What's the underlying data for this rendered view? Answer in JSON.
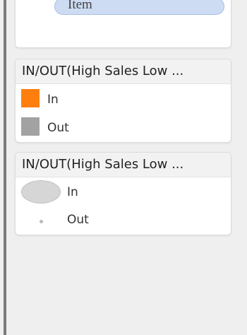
{
  "top_panel": {
    "item_label": "Item"
  },
  "color_legend": {
    "title": "IN/OUT(High Sales Low ...",
    "items": [
      {
        "label": "In",
        "color": "#ff7f0e"
      },
      {
        "label": "Out",
        "color": "#a2a2a2"
      }
    ]
  },
  "size_legend": {
    "title": "IN/OUT(High Sales Low ...",
    "items": [
      {
        "label": "In",
        "marker": "large-circle"
      },
      {
        "label": "Out",
        "marker": "small-circle"
      }
    ]
  }
}
